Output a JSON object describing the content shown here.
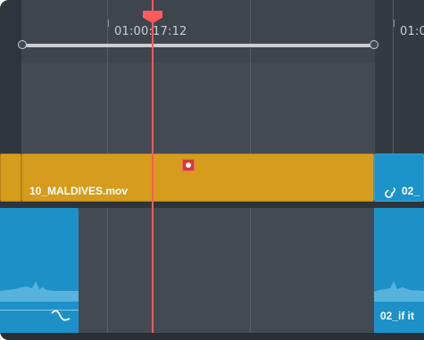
{
  "ruler": {
    "timecodes": [
      "01:00:17:12",
      "01:0"
    ]
  },
  "clips": {
    "video_main": "10_MALDIVES.mov",
    "video_right": "02_",
    "audio_right": "02_if it"
  },
  "colors": {
    "timeline_bg": "#444a53",
    "video_clip": "#d59c1d",
    "audio_clip": "#1d91c7",
    "playhead": "#ff5b5b",
    "marker": "#d33b37"
  },
  "icons": {
    "link": "link-icon",
    "fade": "fade-curve-icon",
    "marker": "marker-icon",
    "playhead": "playhead-icon"
  }
}
